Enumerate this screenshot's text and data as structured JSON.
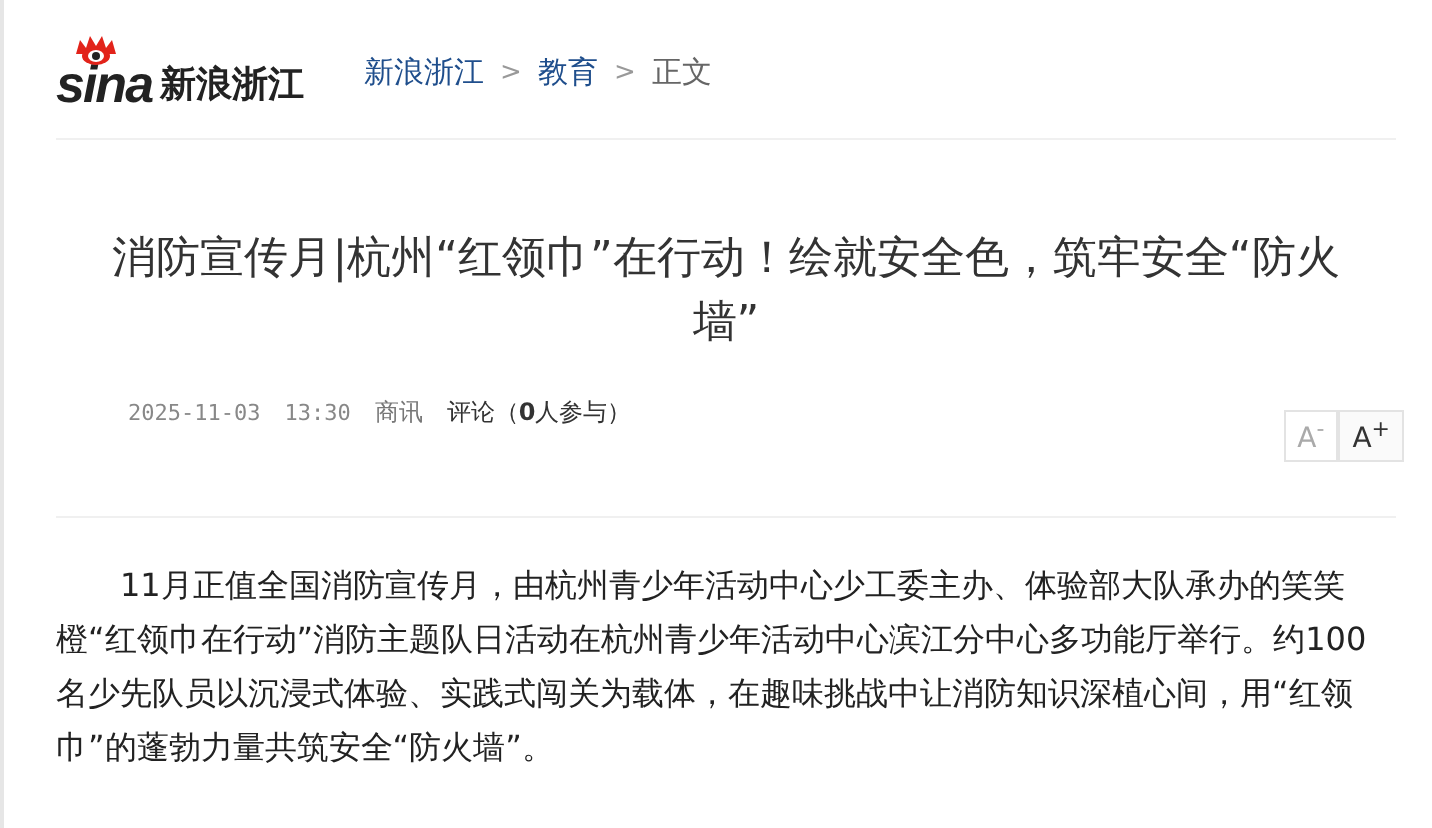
{
  "header": {
    "logo_text": "sina",
    "site_name": "新浪浙江",
    "breadcrumb": [
      {
        "label": "新浪浙江",
        "link": true
      },
      {
        "label": "教育",
        "link": true
      },
      {
        "label": "正文",
        "link": false
      }
    ],
    "separator": ">"
  },
  "article": {
    "title": "消防宣传月|杭州“红领巾”在行动！绘就安全色，筑牢安全“防火墙”",
    "date": "2025-11-03",
    "time": "13:30",
    "source": "商讯",
    "comments": "评论（**0**人参与）",
    "font_buttons": [
      {
        "letter": "A",
        "sign": "-",
        "disabled": true
      },
      {
        "letter": "A",
        "sign": "+",
        "disabled": false
      }
    ],
    "paragraphs": [
      "11月正值全国消防宣传月，由杭州青少年活动中心少工委主办、体验部大队承办的笑笑橙“红领巾在行动”消防主题队日活动在杭州青少年活动中心滨江分中心多功能厅举行。约100名少先队员以沉浸式体验、实践式闯关为载体，在趣味挑战中让消防知识深植心间，用“红领巾”的蓬勃力量共筑安全“防火墙”。"
    ]
  }
}
